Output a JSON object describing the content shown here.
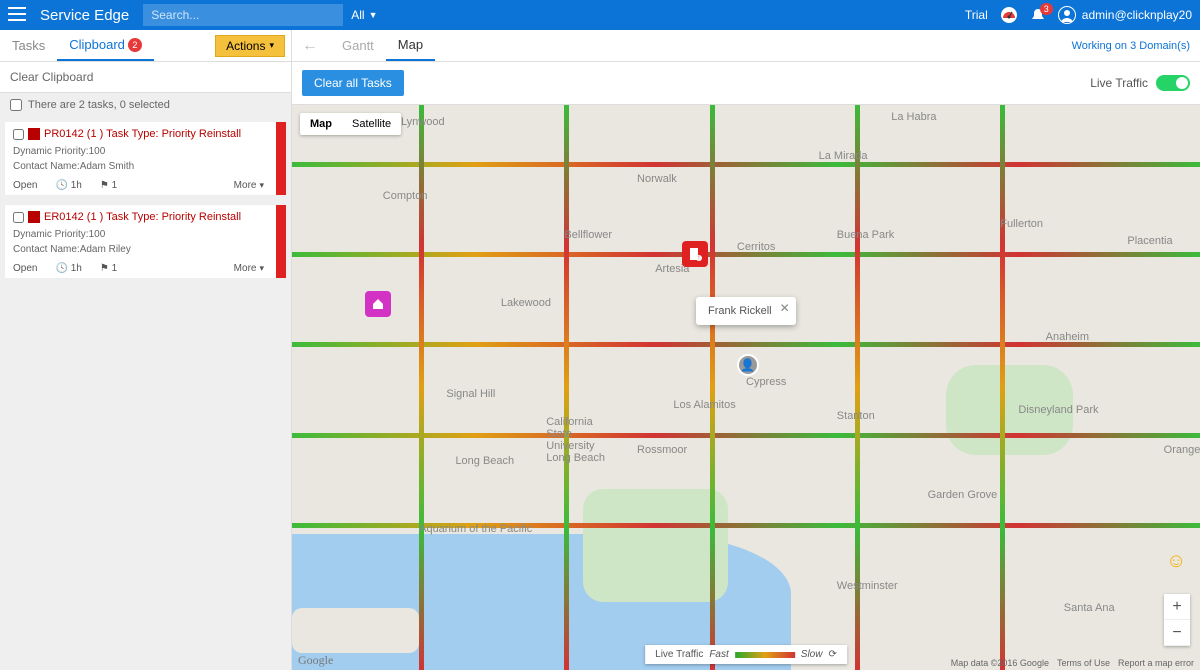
{
  "header": {
    "brand": "Service Edge",
    "search_placeholder": "Search...",
    "filter_label": "All",
    "trial": "Trial",
    "notif_count": "3",
    "user": "admin@clicknplay20"
  },
  "leftTabs": {
    "tasks": "Tasks",
    "clipboard": "Clipboard",
    "clipboard_count": "2",
    "actions": "Actions"
  },
  "rightTabs": {
    "gantt": "Gantt",
    "map": "Map",
    "domains": "Working on 3 Domain(s)"
  },
  "sidebar": {
    "clear": "Clear Clipboard",
    "summary": "There are 2 tasks, 0 selected"
  },
  "cards": [
    {
      "title": "PR0142 (1 ) Task Type: Priority Reinstall",
      "priority": "Dynamic Priority:100",
      "contact": "Contact Name:Adam Smith",
      "status": "Open",
      "dur": "1h",
      "flag": "1",
      "more": "More"
    },
    {
      "title": "ER0142 (1 ) Task Type: Priority Reinstall",
      "priority": "Dynamic Priority:100",
      "contact": "Contact Name:Adam Riley",
      "status": "Open",
      "dur": "1h",
      "flag": "1",
      "more": "More"
    }
  ],
  "mainbar": {
    "clear_all": "Clear all Tasks",
    "live_traffic": "Live Traffic"
  },
  "map": {
    "type_map": "Map",
    "type_sat": "Satellite",
    "info_name": "Frank Rickell",
    "legend_label": "Live Traffic",
    "legend_fast": "Fast",
    "legend_slow": "Slow",
    "google": "Google",
    "attrib1": "Map data ©2016 Google",
    "attrib2": "Terms of Use",
    "attrib3": "Report a map error",
    "cities": {
      "compton": "Compton",
      "lynwood": "Lynwood",
      "norwalk": "Norwalk",
      "bellflower": "Bellflower",
      "lakewood": "Lakewood",
      "artesia": "Artesia",
      "cerritos": "Cerritos",
      "buenapark": "Buena Park",
      "lamirada": "La Mirada",
      "fullerton": "Fullerton",
      "anaheim": "Anaheim",
      "cypress": "Cypress",
      "longbeach": "Long Beach",
      "signalhill": "Signal Hill",
      "gardengrove": "Garden Grove",
      "westminster": "Westminster",
      "santaana": "Santa Ana",
      "orange": "Orange",
      "disneyland": "Disneyland Park",
      "lahabra": "La Habra",
      "placentia": "Placentia",
      "losalamitos": "Los Alamitos",
      "rossmoor": "Rossmoor",
      "csulb": "California\nState\nUniversity\nLong Beach",
      "aquarium": "Aquarium of the Pacific",
      "stanton": "Stanton"
    }
  }
}
